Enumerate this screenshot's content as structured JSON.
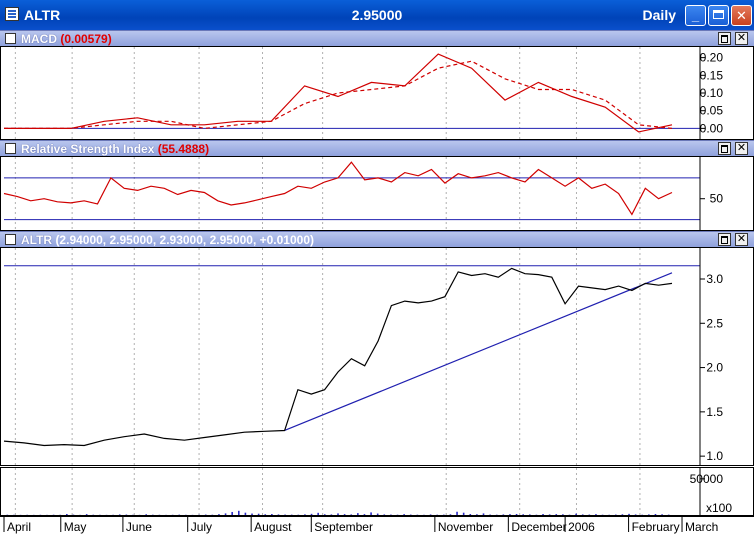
{
  "window": {
    "symbol": "ALTR",
    "price": "2.95000",
    "period": "Daily",
    "buttons": {
      "minimize": "_",
      "maximize": "",
      "close": "✕"
    }
  },
  "panes": {
    "macd": {
      "title": "MACD ",
      "value": "(0.00579)"
    },
    "rsi": {
      "title": "Relative Strength Index ",
      "value": "(55.4888)"
    },
    "price": {
      "title": "ALTR ",
      "value": "(2.94000, 2.95000, 2.93000, 2.95000, +0.01000)"
    },
    "close_label": "✕"
  },
  "volume_unit": "x100",
  "chart_data": [
    {
      "type": "line",
      "name": "MACD",
      "x": [
        0,
        5,
        10,
        15,
        20,
        25,
        30,
        35,
        40,
        45,
        50,
        55,
        60,
        65,
        70,
        75,
        80,
        85,
        90,
        95,
        100
      ],
      "series": [
        {
          "values": [
            0.0,
            0.0,
            0.0,
            0.02,
            0.03,
            0.01,
            0.01,
            0.02,
            0.02,
            0.12,
            0.09,
            0.13,
            0.12,
            0.21,
            0.17,
            0.08,
            0.13,
            0.09,
            0.06,
            -0.01,
            0.01
          ],
          "color": "#d00000"
        },
        {
          "values": [
            0.0,
            0.0,
            0.0,
            0.01,
            0.02,
            0.02,
            0.0,
            0.01,
            0.02,
            0.07,
            0.1,
            0.11,
            0.12,
            0.17,
            0.19,
            0.14,
            0.11,
            0.11,
            0.08,
            0.01,
            0.0
          ],
          "color": "#d00000",
          "dashed": true
        }
      ],
      "ylim": [
        -0.03,
        0.23
      ],
      "yticks": [
        "0.20",
        "0.15",
        "0.10",
        "0.05",
        "0.00"
      ],
      "ytick_values": [
        0.2,
        0.15,
        0.1,
        0.05,
        0.0
      ]
    },
    {
      "type": "line",
      "name": "RSI",
      "x": [
        0,
        2,
        4,
        6,
        8,
        10,
        12,
        14,
        16,
        18,
        20,
        22,
        24,
        26,
        28,
        30,
        32,
        34,
        36,
        38,
        40,
        42,
        44,
        46,
        48,
        50,
        52,
        54,
        56,
        58,
        60,
        62,
        64,
        66,
        68,
        70,
        72,
        74,
        76,
        78,
        80,
        82,
        84,
        86,
        88,
        90,
        92,
        94,
        96,
        98,
        100
      ],
      "series": [
        {
          "values": [
            55,
            52,
            48,
            50,
            47,
            46,
            48,
            45,
            70,
            60,
            58,
            62,
            60,
            54,
            58,
            56,
            48,
            44,
            46,
            49,
            52,
            55,
            62,
            60,
            66,
            70,
            85,
            68,
            70,
            66,
            75,
            72,
            78,
            65,
            74,
            70,
            72,
            75,
            70,
            66,
            78,
            70,
            62,
            70,
            60,
            64,
            55,
            35,
            60,
            50,
            56
          ],
          "color": "#d00000"
        }
      ],
      "ylim": [
        20,
        90
      ],
      "yticks": [
        "50"
      ],
      "ytick_values": [
        50
      ],
      "hlines": [
        70,
        30
      ]
    },
    {
      "type": "line",
      "name": "ALTR",
      "x": [
        0,
        3,
        6,
        9,
        12,
        15,
        18,
        21,
        24,
        27,
        30,
        33,
        36,
        39,
        42,
        44,
        46,
        48,
        50,
        52,
        54,
        56,
        58,
        60,
        62,
        64,
        66,
        68,
        70,
        72,
        74,
        76,
        78,
        80,
        82,
        84,
        86,
        88,
        90,
        92,
        94,
        96,
        98,
        100
      ],
      "series": [
        {
          "values": [
            1.17,
            1.15,
            1.12,
            1.13,
            1.12,
            1.18,
            1.22,
            1.25,
            1.2,
            1.18,
            1.21,
            1.24,
            1.27,
            1.28,
            1.29,
            1.75,
            1.7,
            1.75,
            1.95,
            2.1,
            2.02,
            2.3,
            2.7,
            2.75,
            2.73,
            2.75,
            2.8,
            3.08,
            3.04,
            3.06,
            3.02,
            3.12,
            3.06,
            3.05,
            3.02,
            2.72,
            2.92,
            2.9,
            2.88,
            2.92,
            2.87,
            2.95,
            2.93,
            2.95
          ],
          "color": "#000000"
        }
      ],
      "trendline": [
        [
          42,
          1.29
        ],
        [
          100,
          3.07
        ]
      ],
      "resistance": 3.15,
      "ylim": [
        0.9,
        3.35
      ],
      "yticks": [
        "3.0",
        "2.5",
        "2.0",
        "1.5",
        "1.0"
      ],
      "ytick_values": [
        3.0,
        2.5,
        2.0,
        1.5,
        1.0
      ]
    },
    {
      "type": "bar",
      "name": "Volume",
      "values": [
        4,
        3,
        2,
        3,
        2,
        3,
        2,
        4,
        3,
        14,
        5,
        2,
        12,
        4,
        3,
        2,
        3,
        8,
        6,
        3,
        2,
        10,
        4,
        3,
        2,
        3,
        5,
        3,
        2,
        3,
        6,
        4,
        12,
        22,
        42,
        58,
        32,
        20,
        18,
        10,
        14,
        8,
        6,
        5,
        4,
        9,
        16,
        30,
        10,
        8,
        22,
        12,
        8,
        26,
        12,
        36,
        20,
        8,
        6,
        4,
        12,
        6,
        4,
        3,
        8,
        4,
        5,
        10,
        45,
        32,
        14,
        10,
        22,
        6,
        4,
        8,
        12,
        14,
        10,
        8,
        4,
        14,
        8,
        12,
        10,
        4,
        18,
        8,
        6,
        12,
        4,
        3,
        6,
        10,
        16,
        8,
        4,
        8,
        14,
        10,
        5
      ],
      "color": "#2a2ac8",
      "yticks": [
        "50000"
      ],
      "ytick_values": [
        500
      ],
      "ylim": [
        0,
        650
      ]
    }
  ],
  "x_axis": {
    "labels": [
      "April",
      "May",
      "June",
      "July",
      "August",
      "September",
      "November",
      "December",
      "2006",
      "February",
      "March"
    ],
    "positions": [
      0,
      8.5,
      17.8,
      27.5,
      37,
      46,
      64.5,
      75.5,
      84,
      93.5,
      101.5
    ]
  }
}
